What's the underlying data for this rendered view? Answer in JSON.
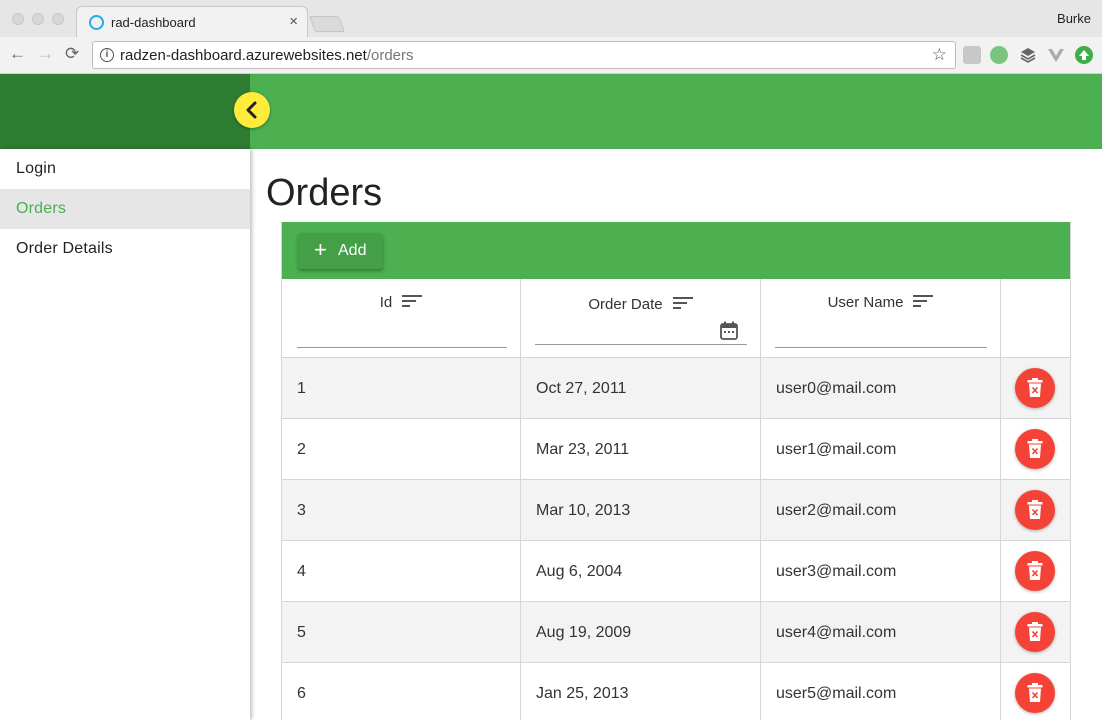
{
  "browser": {
    "tab_title": "rad-dashboard",
    "tab_close": "×",
    "profile": "Burke",
    "url_host": "radzen-dashboard.azurewebsites.net",
    "url_path": "/orders",
    "info_glyph": "i",
    "back_glyph": "←",
    "forward_glyph": "→",
    "reload_glyph": "⟳",
    "star_glyph": "☆"
  },
  "sidebar": {
    "items": [
      {
        "label": "Login",
        "active": false
      },
      {
        "label": "Orders",
        "active": true
      },
      {
        "label": "Order Details",
        "active": false
      }
    ]
  },
  "page": {
    "title": "Orders",
    "add_label": "Add",
    "add_glyph": "+"
  },
  "grid": {
    "columns": [
      "Id",
      "Order Date",
      "User Name"
    ],
    "rows": [
      {
        "id": "1",
        "date": "Oct 27, 2011",
        "user": "user0@mail.com"
      },
      {
        "id": "2",
        "date": "Mar 23, 2011",
        "user": "user1@mail.com"
      },
      {
        "id": "3",
        "date": "Mar 10, 2013",
        "user": "user2@mail.com"
      },
      {
        "id": "4",
        "date": "Aug 6, 2004",
        "user": "user3@mail.com"
      },
      {
        "id": "5",
        "date": "Aug 19, 2009",
        "user": "user4@mail.com"
      },
      {
        "id": "6",
        "date": "Jan 25, 2013",
        "user": "user5@mail.com"
      }
    ]
  },
  "colors": {
    "primary": "#4caf50",
    "primary_dark": "#2e7d32",
    "accent": "#ffeb3b",
    "danger": "#f44336"
  }
}
